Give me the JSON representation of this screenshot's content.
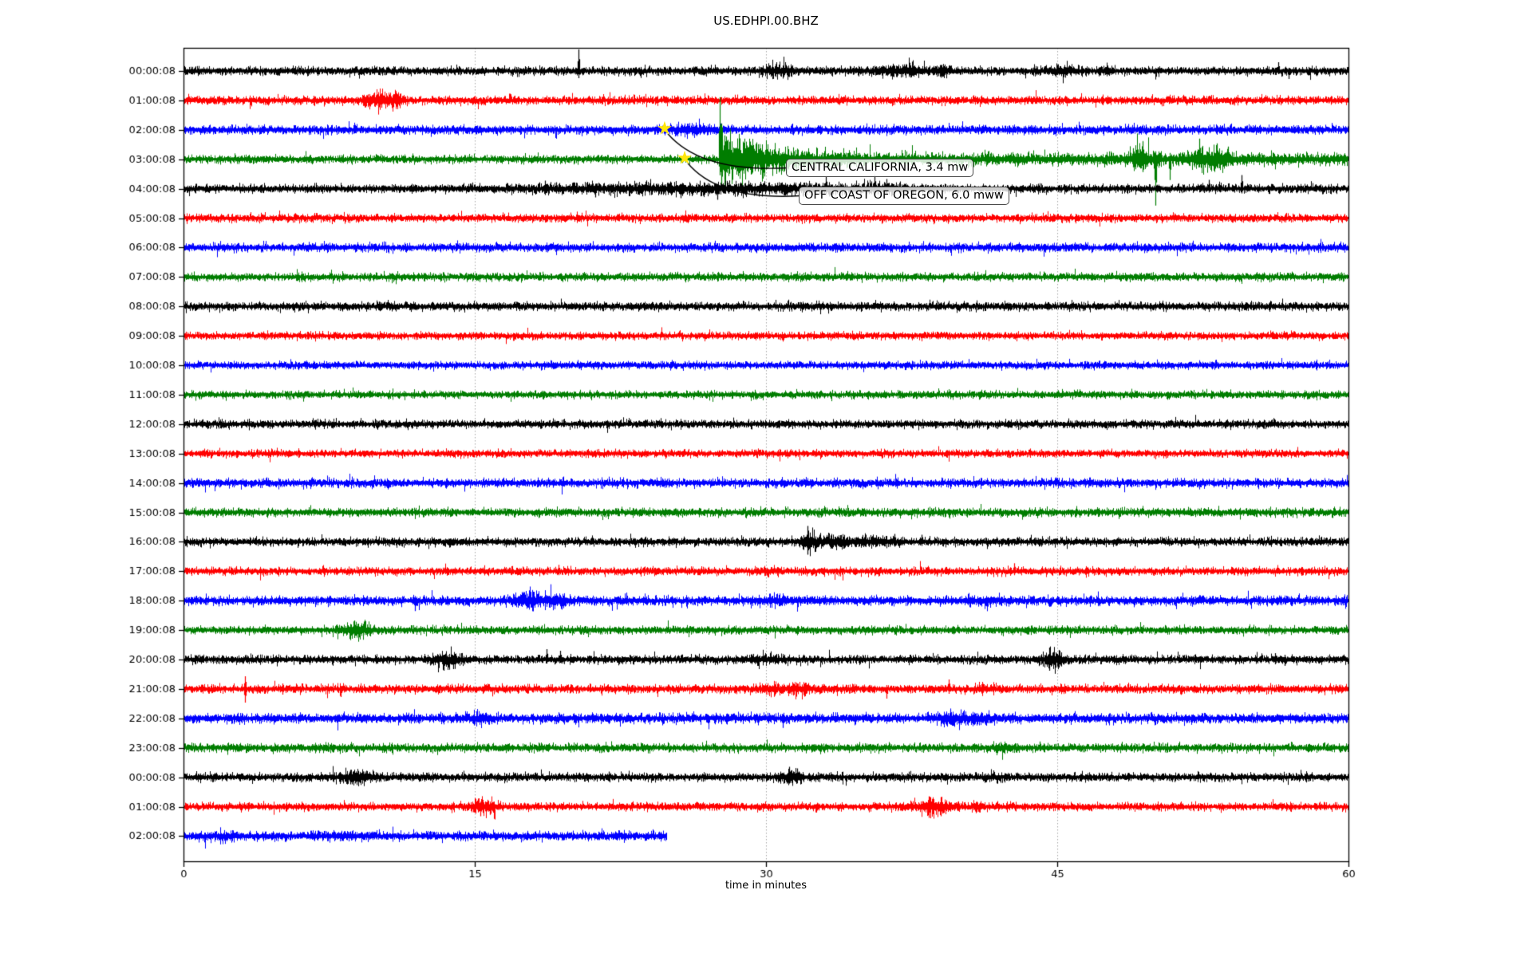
{
  "title": "US.EDHPI.00.BHZ",
  "chart_data": {
    "type": "line",
    "subtype": "helicorder-seismogram",
    "title": "US.EDHPI.00.BHZ",
    "xlabel": "time in minutes",
    "xlim": [
      0,
      60
    ],
    "x_ticks": [
      0,
      15,
      30,
      45,
      60
    ],
    "x_tick_labels": [
      "0",
      "15",
      "30",
      "45",
      "60"
    ],
    "grid": {
      "vertical_at": [
        15,
        30,
        45
      ],
      "style": "dotted",
      "color": "#a6a6a6"
    },
    "trace_colors": {
      "k": "#000000",
      "r": "#ff0000",
      "b": "#0000ff",
      "g": "#007d00"
    },
    "rows": [
      {
        "label": "00:00:08",
        "color": "k",
        "amp": 1.0,
        "bursts": [
          {
            "t": 30.6,
            "d": 0.8,
            "m": 0.9
          },
          {
            "t": 37.0,
            "d": 1.3,
            "m": 1.0
          },
          {
            "t": 39.0,
            "d": 0.3,
            "m": 0.8
          },
          {
            "t": 45.2,
            "d": 0.8,
            "m": 0.7
          },
          {
            "t": 47.5,
            "d": 0.4,
            "m": 0.5
          }
        ],
        "spikes": [
          {
            "t": 20.35,
            "u": 27,
            "d": 9
          },
          {
            "t": 56.4,
            "u": 11,
            "d": 4
          },
          {
            "t": 56.9,
            "u": 4,
            "d": 10
          }
        ]
      },
      {
        "label": "01:00:08",
        "color": "r",
        "amp": 1.0,
        "bursts": [
          {
            "t": 10.1,
            "d": 0.7,
            "m": 1.6
          },
          {
            "t": 11.0,
            "d": 0.3,
            "m": 1.2
          }
        ],
        "spikes": [
          {
            "t": 6.7,
            "u": 6,
            "d": 6
          },
          {
            "t": 10.2,
            "u": 9,
            "d": 9
          }
        ]
      },
      {
        "label": "02:00:08",
        "color": "b",
        "amp": 1.05,
        "bursts": [
          {
            "t": 26.2,
            "d": 1.0,
            "m": 0.9
          }
        ],
        "spikes": []
      },
      {
        "label": "03:00:08",
        "color": "g",
        "amp": 0.95,
        "coda": {
          "t": 27.6,
          "a": 5.5,
          "tau": 2.8,
          "floor": 0.55
        },
        "bursts": [
          {
            "t": 49.4,
            "d": 0.5,
            "m": 2.0
          },
          {
            "t": 52.6,
            "d": 0.9,
            "m": 1.6
          },
          {
            "t": 53.6,
            "d": 0.4,
            "m": 1.2
          }
        ],
        "spikes": [
          {
            "t": 27.6,
            "u": 78,
            "d": 20
          },
          {
            "t": 27.7,
            "u": 45,
            "d": 34
          },
          {
            "t": 27.85,
            "u": 30,
            "d": 25
          },
          {
            "t": 28.1,
            "u": 22,
            "d": 18
          },
          {
            "t": 48.9,
            "u": 14,
            "d": 10
          },
          {
            "t": 49.4,
            "u": 22,
            "d": 16
          },
          {
            "t": 50.05,
            "u": 10,
            "d": 58
          },
          {
            "t": 50.8,
            "u": 8,
            "d": 26
          },
          {
            "t": 52.3,
            "u": 26,
            "d": 10
          },
          {
            "t": 53.2,
            "u": 20,
            "d": 8
          },
          {
            "t": 53.8,
            "u": 16,
            "d": 8
          }
        ]
      },
      {
        "label": "04:00:08",
        "color": "k",
        "amp": 1.0,
        "bursts": [
          {
            "t": 23.0,
            "d": 5.0,
            "m": 0.5
          },
          {
            "t": 30.0,
            "d": 5.0,
            "m": 0.6
          },
          {
            "t": 36.0,
            "d": 2.0,
            "m": 0.5
          }
        ],
        "spikes": [
          {
            "t": 18.6,
            "u": 10,
            "d": 8
          },
          {
            "t": 19.2,
            "u": 8,
            "d": 6
          },
          {
            "t": 21.2,
            "u": 6,
            "d": 11
          },
          {
            "t": 25.6,
            "u": 6,
            "d": 12
          },
          {
            "t": 27.5,
            "u": 5,
            "d": 14
          },
          {
            "t": 33.1,
            "u": 16,
            "d": 8
          },
          {
            "t": 35.6,
            "u": 17,
            "d": 9
          },
          {
            "t": 36.2,
            "u": 12,
            "d": 7
          },
          {
            "t": 52.8,
            "u": 11,
            "d": 5
          },
          {
            "t": 54.5,
            "u": 17,
            "d": 6
          }
        ]
      },
      {
        "label": "05:00:08",
        "color": "r",
        "amp": 0.95,
        "bursts": [],
        "spikes": []
      },
      {
        "label": "06:00:08",
        "color": "b",
        "amp": 1.0,
        "bursts": [],
        "spikes": []
      },
      {
        "label": "07:00:08",
        "color": "g",
        "amp": 0.95,
        "bursts": [],
        "spikes": []
      },
      {
        "label": "08:00:08",
        "color": "k",
        "amp": 1.0,
        "bursts": [],
        "spikes": []
      },
      {
        "label": "09:00:08",
        "color": "r",
        "amp": 0.9,
        "bursts": [],
        "spikes": []
      },
      {
        "label": "10:00:08",
        "color": "b",
        "amp": 0.9,
        "bursts": [],
        "spikes": []
      },
      {
        "label": "11:00:08",
        "color": "g",
        "amp": 0.9,
        "bursts": [],
        "spikes": []
      },
      {
        "label": "12:00:08",
        "color": "k",
        "amp": 0.95,
        "bursts": [],
        "spikes": []
      },
      {
        "label": "13:00:08",
        "color": "r",
        "amp": 0.9,
        "bursts": [],
        "spikes": []
      },
      {
        "label": "14:00:08",
        "color": "b",
        "amp": 1.05,
        "bursts": [],
        "spikes": []
      },
      {
        "label": "15:00:08",
        "color": "g",
        "amp": 1.0,
        "bursts": [],
        "spikes": []
      },
      {
        "label": "16:00:08",
        "color": "k",
        "amp": 1.0,
        "bursts": [
          {
            "t": 32.2,
            "d": 0.35,
            "m": 1.8
          },
          {
            "t": 33.5,
            "d": 1.5,
            "m": 0.8
          },
          {
            "t": 35.8,
            "d": 0.8,
            "m": 0.6
          }
        ],
        "spikes": [
          {
            "t": 32.15,
            "u": 20,
            "d": 16
          },
          {
            "t": 36.6,
            "u": 10,
            "d": 6
          },
          {
            "t": 38.0,
            "u": 9,
            "d": 5
          }
        ]
      },
      {
        "label": "17:00:08",
        "color": "r",
        "amp": 0.95,
        "bursts": [
          {
            "t": 30.0,
            "d": 0.5,
            "m": 0.4
          }
        ],
        "spikes": [
          {
            "t": 19.3,
            "u": 8,
            "d": 5
          },
          {
            "t": 42.8,
            "u": 10,
            "d": 5
          }
        ]
      },
      {
        "label": "18:00:08",
        "color": "b",
        "amp": 1.1,
        "bursts": [
          {
            "t": 17.8,
            "d": 0.8,
            "m": 1.2
          },
          {
            "t": 19.3,
            "d": 0.5,
            "m": 0.9
          },
          {
            "t": 30.5,
            "d": 1.2,
            "m": 0.5
          },
          {
            "t": 41.0,
            "d": 0.8,
            "m": 0.4
          }
        ],
        "spikes": [
          {
            "t": 11.9,
            "u": 5,
            "d": 13
          }
        ]
      },
      {
        "label": "19:00:08",
        "color": "g",
        "amp": 0.95,
        "bursts": [
          {
            "t": 8.9,
            "d": 0.7,
            "m": 1.6
          }
        ],
        "spikes": [
          {
            "t": 8.8,
            "u": 12,
            "d": 10
          }
        ]
      },
      {
        "label": "20:00:08",
        "color": "k",
        "amp": 1.0,
        "bursts": [
          {
            "t": 13.6,
            "d": 0.7,
            "m": 1.0
          },
          {
            "t": 30.2,
            "d": 0.9,
            "m": 0.5
          },
          {
            "t": 44.8,
            "d": 0.6,
            "m": 1.4
          }
        ],
        "spikes": [
          {
            "t": 13.4,
            "u": 6,
            "d": 14
          },
          {
            "t": 13.9,
            "u": 5,
            "d": 12
          },
          {
            "t": 18.7,
            "u": 13,
            "d": 5
          },
          {
            "t": 19.4,
            "u": 11,
            "d": 4
          },
          {
            "t": 44.6,
            "u": 15,
            "d": 14
          },
          {
            "t": 45.1,
            "u": 12,
            "d": 10
          },
          {
            "t": 56.2,
            "u": 8,
            "d": 6
          },
          {
            "t": 56.7,
            "u": 6,
            "d": 8
          }
        ]
      },
      {
        "label": "21:00:08",
        "color": "r",
        "amp": 1.0,
        "bursts": [
          {
            "t": 30.2,
            "d": 0.6,
            "m": 0.8
          },
          {
            "t": 31.7,
            "d": 0.7,
            "m": 0.9
          },
          {
            "t": 41.3,
            "d": 0.5,
            "m": 0.5
          }
        ],
        "spikes": [
          {
            "t": 3.15,
            "u": 16,
            "d": 17
          },
          {
            "t": 5.1,
            "u": 7,
            "d": 7
          },
          {
            "t": 8.1,
            "u": 4,
            "d": 10
          },
          {
            "t": 36.2,
            "u": 5,
            "d": 12
          },
          {
            "t": 39.4,
            "u": 12,
            "d": 6
          }
        ]
      },
      {
        "label": "22:00:08",
        "color": "b",
        "amp": 1.15,
        "bursts": [
          {
            "t": 15.3,
            "d": 0.6,
            "m": 0.7
          },
          {
            "t": 39.6,
            "d": 0.8,
            "m": 0.7
          },
          {
            "t": 41.0,
            "d": 1.0,
            "m": 0.4
          }
        ],
        "spikes": [
          {
            "t": 30.85,
            "u": 5,
            "d": 12
          },
          {
            "t": 39.5,
            "u": 10,
            "d": 8
          }
        ]
      },
      {
        "label": "23:00:08",
        "color": "g",
        "amp": 1.0,
        "bursts": [
          {
            "t": 42.2,
            "d": 0.5,
            "m": 0.7
          }
        ],
        "spikes": [
          {
            "t": 44.1,
            "u": 8,
            "d": 4
          }
        ]
      },
      {
        "label": "00:00:08",
        "color": "k",
        "amp": 1.0,
        "bursts": [
          {
            "t": 8.9,
            "d": 0.9,
            "m": 1.1
          },
          {
            "t": 31.3,
            "d": 0.6,
            "m": 1.0
          },
          {
            "t": 41.6,
            "d": 0.5,
            "m": 0.5
          }
        ],
        "spikes": [
          {
            "t": 8.6,
            "u": 9,
            "d": 9
          },
          {
            "t": 21.9,
            "u": 7,
            "d": 4
          },
          {
            "t": 31.2,
            "u": 13,
            "d": 5
          },
          {
            "t": 31.6,
            "u": 11,
            "d": 4
          }
        ]
      },
      {
        "label": "01:00:08",
        "color": "r",
        "amp": 0.95,
        "bursts": [
          {
            "t": 15.5,
            "d": 0.7,
            "m": 1.2
          },
          {
            "t": 38.7,
            "d": 0.9,
            "m": 1.6
          },
          {
            "t": 40.9,
            "d": 0.3,
            "m": 0.7
          }
        ],
        "spikes": [
          {
            "t": 15.3,
            "u": 5,
            "d": 12
          },
          {
            "t": 15.8,
            "u": 4,
            "d": 10
          },
          {
            "t": 38.4,
            "u": 13,
            "d": 14
          },
          {
            "t": 39.0,
            "u": 12,
            "d": 12
          }
        ]
      },
      {
        "label": "02:00:08",
        "color": "b",
        "amp": 1.1,
        "end_t": 24.9,
        "bursts": [
          {
            "t": 2.0,
            "d": 1.0,
            "m": 0.3
          },
          {
            "t": 8.0,
            "d": 1.0,
            "m": 0.3
          }
        ],
        "spikes": []
      }
    ],
    "markers": [
      {
        "icon": "star",
        "glyph": "★",
        "color": "#ffe60a",
        "row": 2,
        "t": 24.78
      },
      {
        "icon": "star",
        "glyph": "★",
        "color": "#ffe60a",
        "row": 3,
        "t": 25.81
      }
    ],
    "annotations": [
      {
        "text": "CENTRAL CALIFORNIA, 3.4 mw",
        "marker": 0,
        "box": {
          "x": 985,
          "y": 199,
          "h": 23
        }
      },
      {
        "text": "OFF COAST OF OREGON, 6.0 mww",
        "marker": 1,
        "box": {
          "x": 1001,
          "y": 234,
          "h": 23
        }
      }
    ],
    "legend_position": "none"
  }
}
